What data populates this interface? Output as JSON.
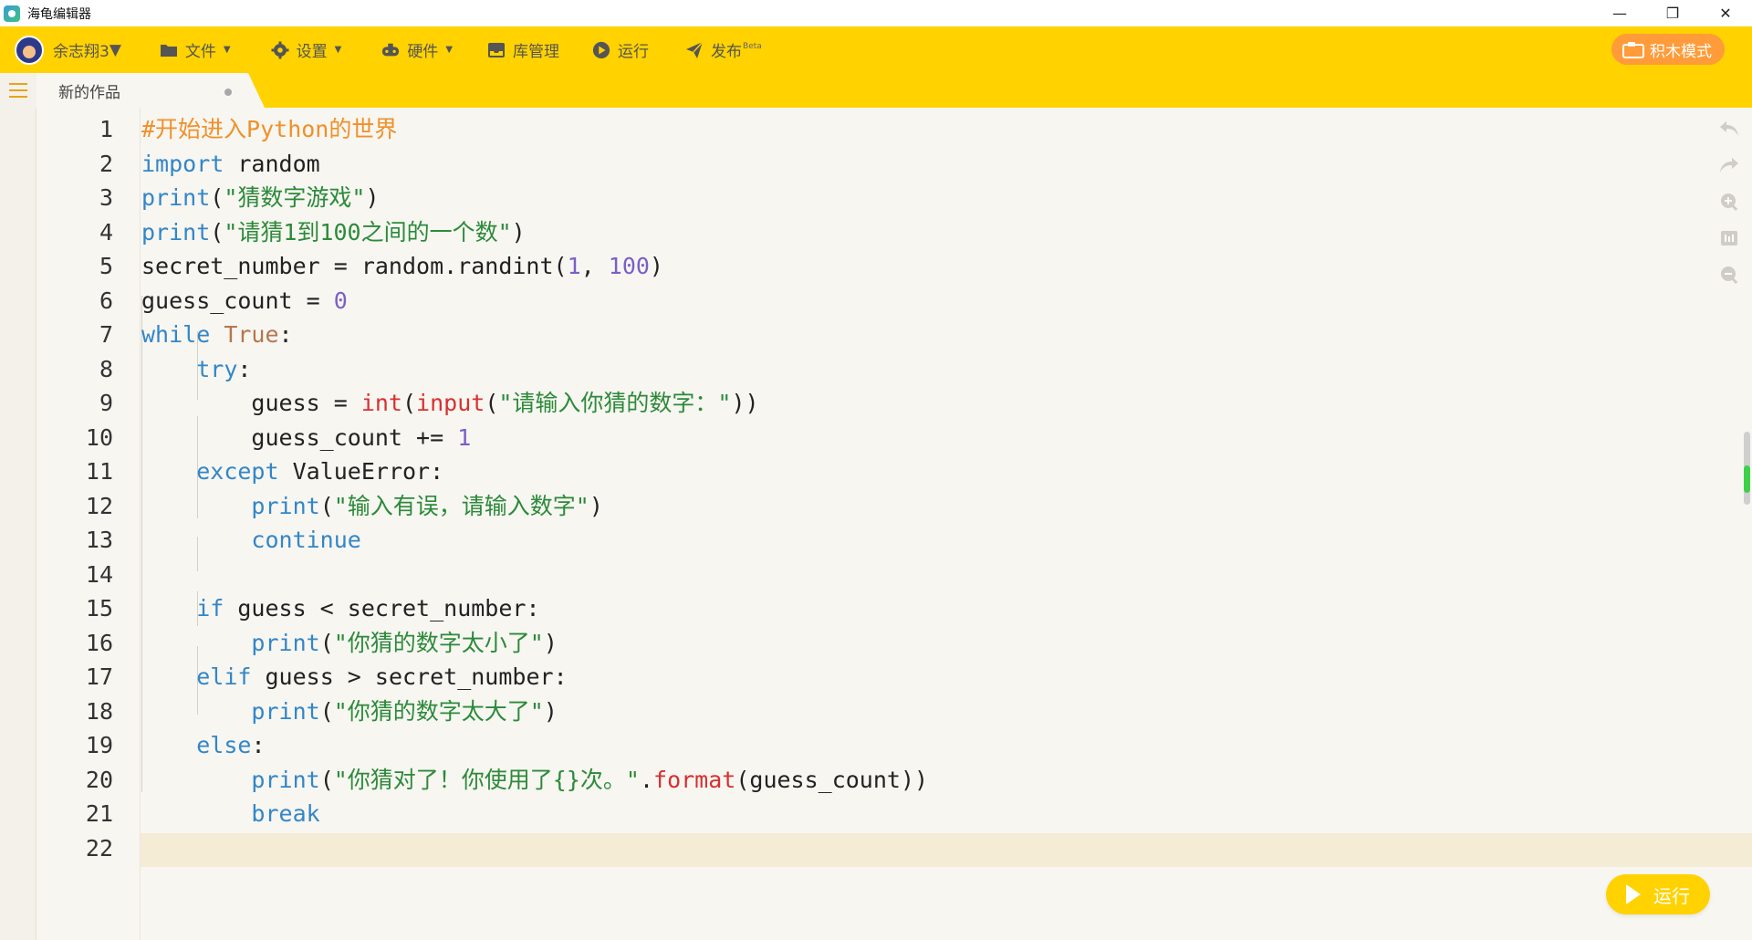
{
  "window": {
    "title": "海龟编辑器",
    "controls": {
      "minimize": "—",
      "maximize": "❐",
      "close": "✕"
    }
  },
  "menu": {
    "user_name": "余志翔3",
    "items": [
      {
        "label": "文件",
        "icon": "folder-icon",
        "has_caret": true
      },
      {
        "label": "设置",
        "icon": "gear-icon",
        "has_caret": true
      },
      {
        "label": "硬件",
        "icon": "gamepad-icon",
        "has_caret": true
      },
      {
        "label": "库管理",
        "icon": "inbox-icon",
        "has_caret": false
      },
      {
        "label": "运行",
        "icon": "play-circle-icon",
        "has_caret": false
      },
      {
        "label": "发布",
        "icon": "paper-plane-icon",
        "has_caret": false,
        "badge": "Beta"
      }
    ],
    "blocks_mode_label": "积木模式",
    "accent_color": "#ffd200",
    "blocks_button_color": "#ff9b38"
  },
  "tab": {
    "label": "新的作品"
  },
  "editor": {
    "lines": [
      {
        "n": "1",
        "tokens": [
          [
            "comment",
            "#开始进入Python的世界"
          ]
        ]
      },
      {
        "n": "2",
        "tokens": [
          [
            "kw",
            "import"
          ],
          [
            "plain",
            " random"
          ]
        ]
      },
      {
        "n": "3",
        "tokens": [
          [
            "kw",
            "print"
          ],
          [
            "plain",
            "("
          ],
          [
            "str",
            "\"猜数字游戏\""
          ],
          [
            "plain",
            ")"
          ]
        ]
      },
      {
        "n": "4",
        "tokens": [
          [
            "kw",
            "print"
          ],
          [
            "plain",
            "("
          ],
          [
            "str",
            "\"请猜1到100之间的一个数\""
          ],
          [
            "plain",
            ")"
          ]
        ]
      },
      {
        "n": "5",
        "tokens": [
          [
            "plain",
            "secret_number = random.randint("
          ],
          [
            "num",
            "1"
          ],
          [
            "plain",
            ", "
          ],
          [
            "num",
            "100"
          ],
          [
            "plain",
            ")"
          ]
        ]
      },
      {
        "n": "6",
        "tokens": [
          [
            "plain",
            "guess_count = "
          ],
          [
            "num",
            "0"
          ]
        ]
      },
      {
        "n": "7",
        "tokens": [
          [
            "kw",
            "while"
          ],
          [
            "plain",
            " "
          ],
          [
            "const",
            "True"
          ],
          [
            "plain",
            ":"
          ]
        ]
      },
      {
        "n": "8",
        "tokens": [
          [
            "plain",
            "    "
          ],
          [
            "kw",
            "try"
          ],
          [
            "plain",
            ":"
          ]
        ]
      },
      {
        "n": "9",
        "tokens": [
          [
            "plain",
            "        guess = "
          ],
          [
            "builtin",
            "int"
          ],
          [
            "plain",
            "("
          ],
          [
            "builtin",
            "input"
          ],
          [
            "plain",
            "("
          ],
          [
            "str",
            "\"请输入你猜的数字：\""
          ],
          [
            "plain",
            "))"
          ]
        ]
      },
      {
        "n": "10",
        "tokens": [
          [
            "plain",
            "        guess_count += "
          ],
          [
            "num",
            "1"
          ]
        ]
      },
      {
        "n": "11",
        "tokens": [
          [
            "plain",
            "    "
          ],
          [
            "kw",
            "except"
          ],
          [
            "plain",
            " ValueError:"
          ]
        ]
      },
      {
        "n": "12",
        "tokens": [
          [
            "plain",
            "        "
          ],
          [
            "kw",
            "print"
          ],
          [
            "plain",
            "("
          ],
          [
            "str",
            "\"输入有误，请输入数字\""
          ],
          [
            "plain",
            ")"
          ]
        ]
      },
      {
        "n": "13",
        "tokens": [
          [
            "plain",
            "        "
          ],
          [
            "kw",
            "continue"
          ]
        ]
      },
      {
        "n": "14",
        "tokens": []
      },
      {
        "n": "15",
        "tokens": [
          [
            "plain",
            "    "
          ],
          [
            "kw",
            "if"
          ],
          [
            "plain",
            " guess < secret_number:"
          ]
        ]
      },
      {
        "n": "16",
        "tokens": [
          [
            "plain",
            "        "
          ],
          [
            "kw",
            "print"
          ],
          [
            "plain",
            "("
          ],
          [
            "str",
            "\"你猜的数字太小了\""
          ],
          [
            "plain",
            ")"
          ]
        ]
      },
      {
        "n": "17",
        "tokens": [
          [
            "plain",
            "    "
          ],
          [
            "kw",
            "elif"
          ],
          [
            "plain",
            " guess > secret_number:"
          ]
        ]
      },
      {
        "n": "18",
        "tokens": [
          [
            "plain",
            "        "
          ],
          [
            "kw",
            "print"
          ],
          [
            "plain",
            "("
          ],
          [
            "str",
            "\"你猜的数字太大了\""
          ],
          [
            "plain",
            ")"
          ]
        ]
      },
      {
        "n": "19",
        "tokens": [
          [
            "plain",
            "    "
          ],
          [
            "kw",
            "else"
          ],
          [
            "plain",
            ":"
          ]
        ]
      },
      {
        "n": "20",
        "tokens": [
          [
            "plain",
            "        "
          ],
          [
            "kw",
            "print"
          ],
          [
            "plain",
            "("
          ],
          [
            "str",
            "\"你猜对了！你使用了{}次。\""
          ],
          [
            "plain",
            "."
          ],
          [
            "builtin",
            "format"
          ],
          [
            "plain",
            "(guess_count))"
          ]
        ]
      },
      {
        "n": "21",
        "tokens": [
          [
            "plain",
            "        "
          ],
          [
            "kw",
            "break"
          ]
        ]
      },
      {
        "n": "22",
        "tokens": []
      }
    ],
    "current_line": "22"
  },
  "right_tools": [
    "undo-icon",
    "redo-icon",
    "zoom-in-icon",
    "font-size-icon",
    "zoom-out-icon"
  ],
  "run_button_label": "运行"
}
